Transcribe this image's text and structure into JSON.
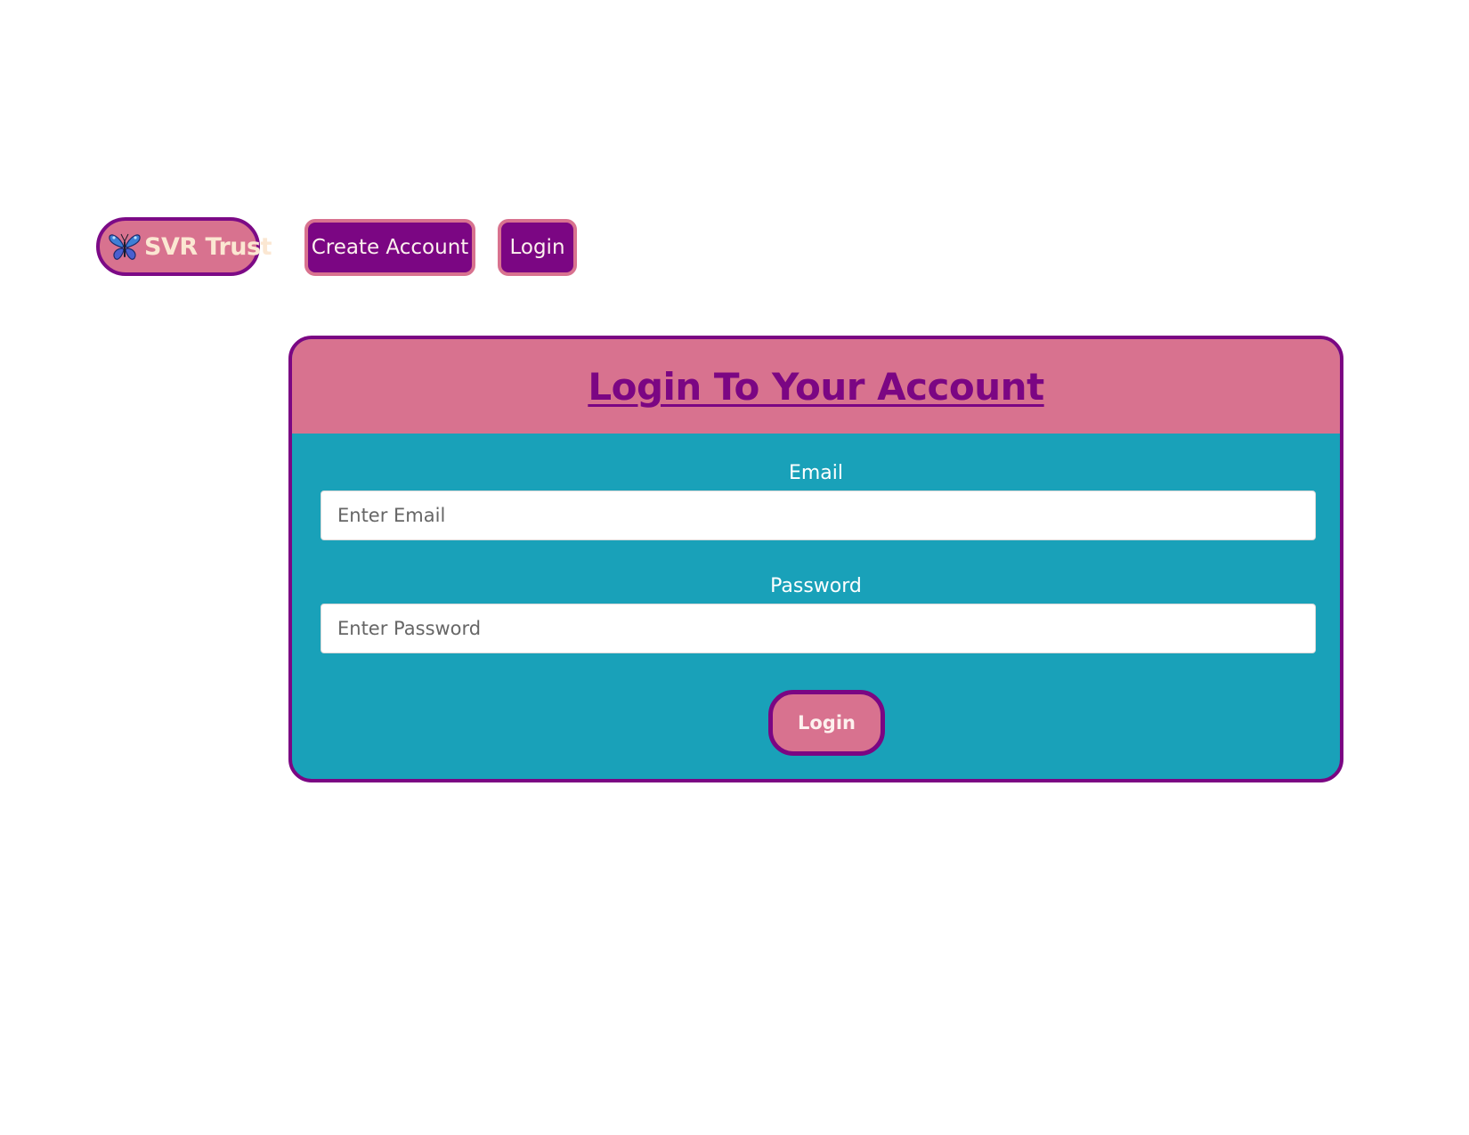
{
  "nav": {
    "brand_label": "SVR Trust",
    "brand_icon": "butterfly-icon",
    "create_account_label": "Create Account",
    "login_label": "Login"
  },
  "login_card": {
    "title": "Login To Your Account",
    "email_label": "Email",
    "email_placeholder": "Enter Email",
    "email_value": "",
    "password_label": "Password",
    "password_placeholder": "Enter Password",
    "password_value": "",
    "submit_label": "Login"
  },
  "colors": {
    "purple": "#7b0683",
    "pink": "#d8728f",
    "teal": "#19a1b9",
    "cream_text": "#fbe7d2"
  }
}
